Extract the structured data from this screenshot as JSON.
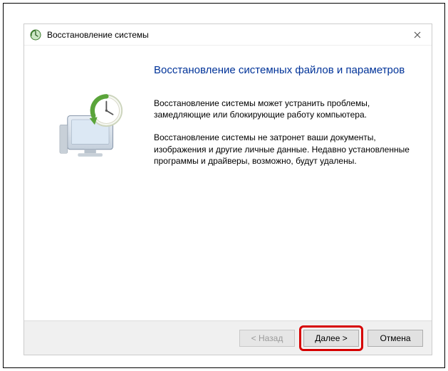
{
  "window": {
    "title": "Восстановление системы"
  },
  "main": {
    "heading": "Восстановление системных файлов и параметров",
    "paragraph1": "Восстановление системы может устранить проблемы, замедляющие или блокирующие работу компьютера.",
    "paragraph2": "Восстановление системы не затронет ваши документы, изображения и другие личные данные. Недавно установленные программы и драйверы, возможно, будут удалены."
  },
  "footer": {
    "back_label": "< Назад",
    "next_label": "Далее >",
    "cancel_label": "Отмена"
  }
}
